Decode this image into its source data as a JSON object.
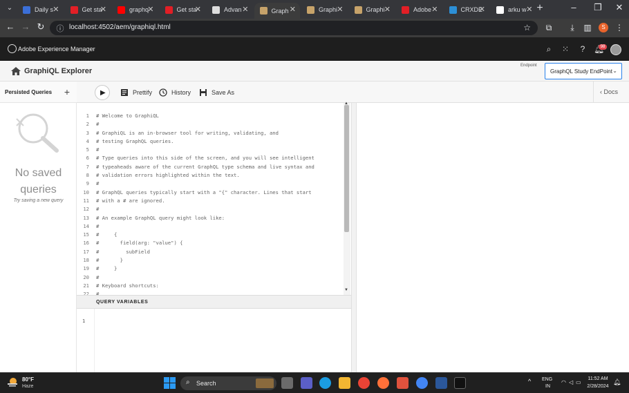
{
  "browser": {
    "tabs": [
      {
        "label": "Daily s",
        "favicon_color": "#3b6fd8"
      },
      {
        "label": "Get sta",
        "favicon_color": "#e21f26"
      },
      {
        "label": "graphq",
        "favicon_color": "#ff0000"
      },
      {
        "label": "Get sta",
        "favicon_color": "#e21f26"
      },
      {
        "label": "Advan",
        "favicon_color": "#dddddd"
      },
      {
        "label": "Graph",
        "favicon_color": "#c7a36a"
      },
      {
        "label": "Graphi",
        "favicon_color": "#c7a36a"
      },
      {
        "label": "Graphi",
        "favicon_color": "#c7a36a"
      },
      {
        "label": "Adobe",
        "favicon_color": "#e21f26"
      },
      {
        "label": "CRXDE",
        "favicon_color": "#2c8fd6"
      },
      {
        "label": "arku w",
        "favicon_color": "#ffffff"
      }
    ],
    "url": "localhost:4502/aem/graphiql.html",
    "profile_initial": "S"
  },
  "aem": {
    "product_name": "Adobe Experience Manager",
    "notification_count": "98"
  },
  "explorer": {
    "title": "GraphiQL Explorer",
    "endpoint_label": "Endpoint",
    "endpoint_value": "GraphQL Study EndPoint"
  },
  "sidebar": {
    "title": "Persisted Queries",
    "empty_title": "No saved queries",
    "empty_hint": "Try saving a new query"
  },
  "toolbar": {
    "prettify": "Prettify",
    "history": "History",
    "save_as": "Save As",
    "docs": "Docs"
  },
  "editor": {
    "lines": [
      "# Welcome to GraphiQL",
      "#",
      "# GraphiQL is an in-browser tool for writing, validating, and",
      "# testing GraphQL queries.",
      "#",
      "# Type queries into this side of the screen, and you will see intelligent",
      "# typeaheads aware of the current GraphQL type schema and live syntax and",
      "# validation errors highlighted within the text.",
      "#",
      "# GraphQL queries typically start with a \"{\" character. Lines that start",
      "# with a # are ignored.",
      "#",
      "# An example GraphQL query might look like:",
      "#",
      "#     {",
      "#       field(arg: \"value\") {",
      "#         subField",
      "#       }",
      "#     }",
      "#",
      "# Keyboard shortcuts:",
      "#"
    ]
  },
  "variables": {
    "title": "QUERY VARIABLES",
    "line_number": "1"
  },
  "taskbar": {
    "weather_temp": "80°F",
    "weather_condition": "Haze",
    "search_label": "Search",
    "language_primary": "ENG",
    "language_secondary": "IN",
    "time": "11:52 AM",
    "date": "2/28/2024"
  }
}
